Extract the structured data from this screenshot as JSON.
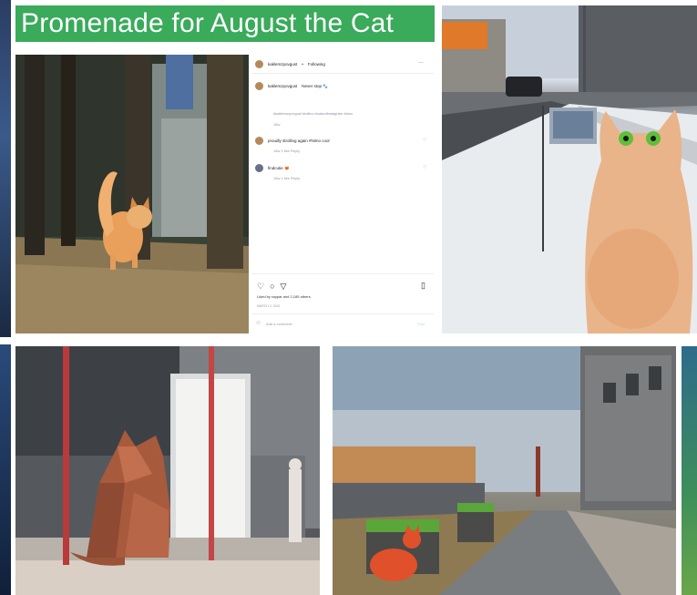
{
  "banner": {
    "title": "Promenade for August the Cat",
    "color": "#3aaa5b"
  },
  "instagram": {
    "username": "kaklemzpovgust",
    "follow_label": "Following",
    "caption_user": "kaklemzpovgust",
    "caption_text": "Never stop 🐾",
    "hashtags": "#kaklemzpovgust #tallinn #catsofinstagram #lasn",
    "caption_time": "18w",
    "comment1_text": "proudly strolling again #Nimo cool",
    "comment1_meta": "18w  1 like  Reply",
    "comment2_text": "findcutie 😻",
    "comment2_meta": "18w  1 like  Reply",
    "liked_by": "Liked by rappar and 2,185 others",
    "date": "MARCH 3, 2021",
    "comment_placeholder": "Add a comment...",
    "post_label": "Post"
  },
  "images": [
    {
      "name": "cat-park-photo",
      "description_icon": "photo"
    },
    {
      "name": "snow-cat-sculpture-photo"
    },
    {
      "name": "low-poly-cat-render"
    },
    {
      "name": "street-promenade-render"
    }
  ]
}
